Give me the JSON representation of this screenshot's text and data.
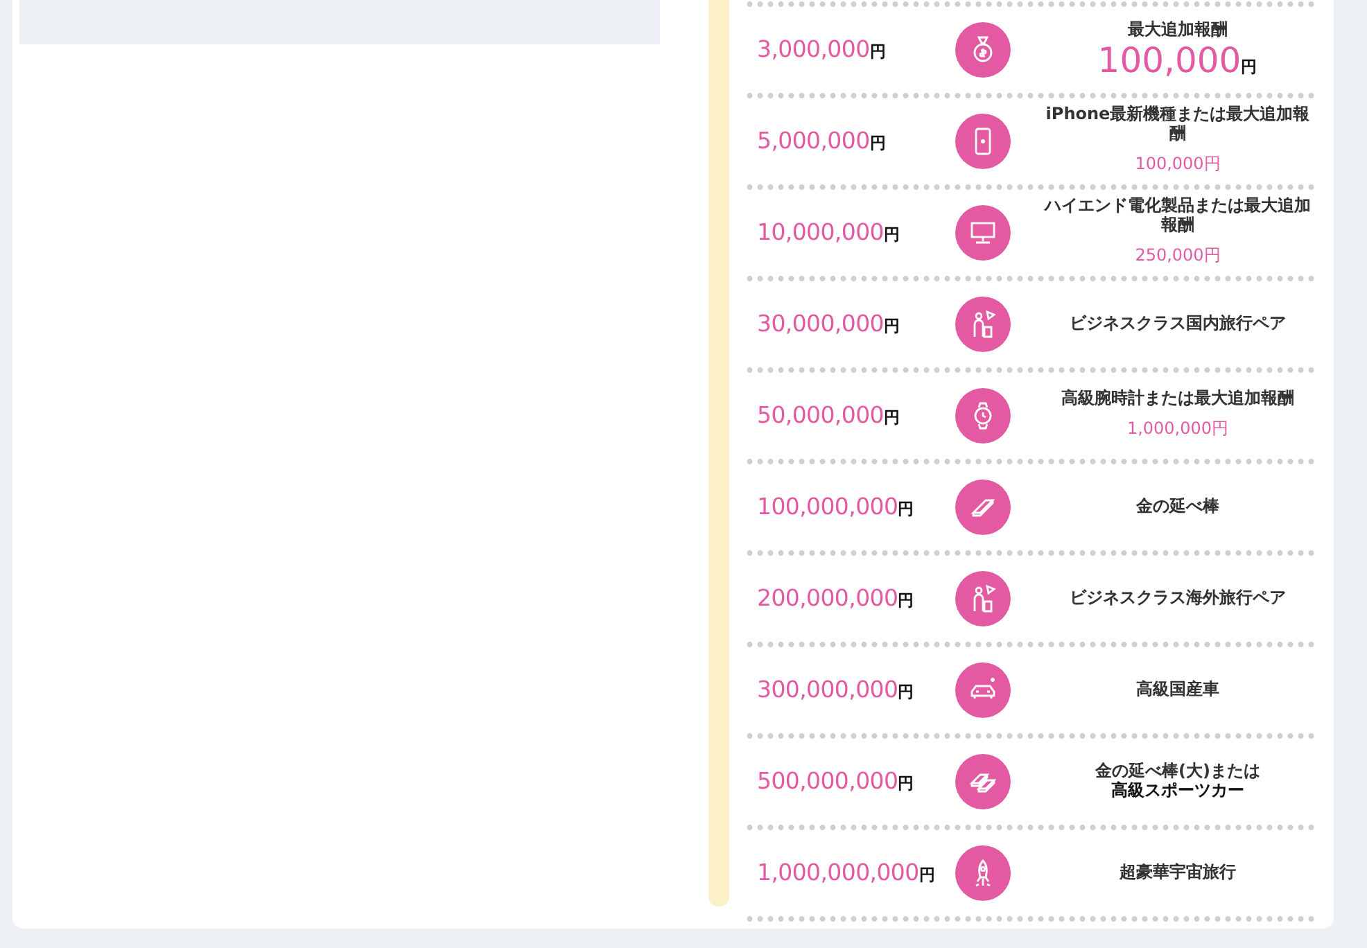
{
  "rewards": [
    {
      "amount": "3,000,000",
      "unit": "円",
      "kind": "bonus",
      "label": "最大追加報酬",
      "bonus": "100,000",
      "bonus_unit": "円"
    },
    {
      "amount": "5,000,000",
      "unit": "円",
      "kind": "item_or_bonus",
      "title": "iPhone最新機種または最大追加報酬",
      "bonus": "100,000円"
    },
    {
      "amount": "10,000,000",
      "unit": "円",
      "kind": "item_or_bonus",
      "title": "ハイエンド電化製品または最大追加報酬",
      "bonus": "250,000円"
    },
    {
      "amount": "30,000,000",
      "unit": "円",
      "kind": "item",
      "lines": [
        "ビジネスクラス国内旅行ペア"
      ]
    },
    {
      "amount": "50,000,000",
      "unit": "円",
      "kind": "item_or_bonus",
      "title": "高級腕時計または最大追加報酬",
      "bonus": "1,000,000円"
    },
    {
      "amount": "100,000,000",
      "unit": "円",
      "kind": "item",
      "lines": [
        "金の延べ棒"
      ]
    },
    {
      "amount": "200,000,000",
      "unit": "円",
      "kind": "item",
      "lines": [
        "ビジネスクラス海外旅行ペア"
      ]
    },
    {
      "amount": "300,000,000",
      "unit": "円",
      "kind": "item",
      "lines": [
        "高級国産車"
      ]
    },
    {
      "amount": "500,000,000",
      "unit": "円",
      "kind": "item",
      "lines": [
        "金の延べ棒(大)または",
        "高級スポーツカー"
      ]
    },
    {
      "amount": "1,000,000,000",
      "unit": "円",
      "kind": "item",
      "lines": [
        "超豪華宇宙旅行"
      ]
    }
  ]
}
